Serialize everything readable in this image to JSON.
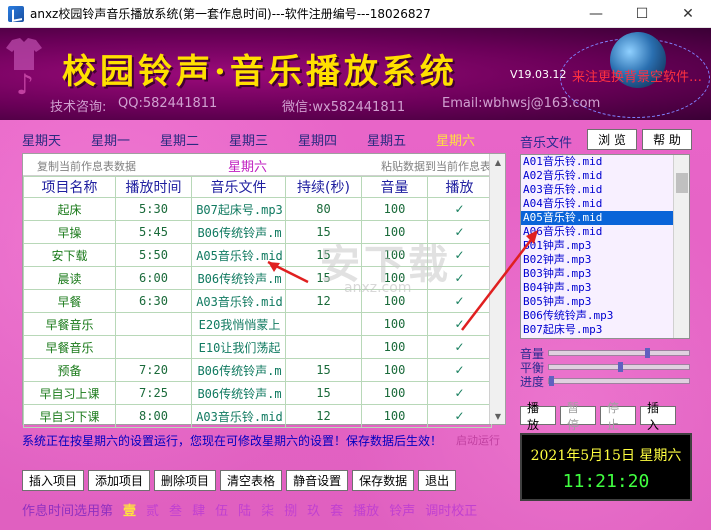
{
  "window": {
    "title": "anxz校园铃声音乐播放系统(第一套作息时间)---软件注册编号---18026827",
    "minimize": "—",
    "maximize": "☐",
    "close": "✕"
  },
  "banner": {
    "title": "校园铃声·音乐播放系统",
    "version": "V19.03.12",
    "scroll_text": "来注更换背景空软件…",
    "tech": "技术咨询:",
    "qq": "QQ:582441811",
    "wechat": "微信:wx582441811",
    "email": "Email:wbhwsj@163.com"
  },
  "weekdays": [
    "星期天",
    "星期一",
    "星期二",
    "星期三",
    "星期四",
    "星期五",
    "星期六"
  ],
  "active_weekday": 6,
  "schedule": {
    "copy_label": "复制当前作息表数据",
    "paste_label": "粘贴数据到当前作息表",
    "day_label": "星期六",
    "headers": [
      "项目名称",
      "播放时间",
      "音乐文件",
      "持续(秒)",
      "音量",
      "播放"
    ],
    "rows": [
      {
        "name": "起床",
        "time": "5:30",
        "file": "B07起床号.mp3",
        "dur": "80",
        "vol": "100",
        "play": "✓"
      },
      {
        "name": "早操",
        "time": "5:45",
        "file": "B06传统铃声.m",
        "dur": "15",
        "vol": "100",
        "play": "✓"
      },
      {
        "name": "安下载",
        "time": "5:50",
        "file": "A05音乐铃.mid",
        "dur": "15",
        "vol": "100",
        "play": "✓"
      },
      {
        "name": "晨读",
        "time": "6:00",
        "file": "B06传统铃声.m",
        "dur": "15",
        "vol": "100",
        "play": "✓"
      },
      {
        "name": "早餐",
        "time": "6:30",
        "file": "A03音乐铃.mid",
        "dur": "12",
        "vol": "100",
        "play": "✓"
      },
      {
        "name": "早餐音乐",
        "time": "",
        "file": "E20我悄悄蒙上",
        "dur": "",
        "vol": "100",
        "play": "✓"
      },
      {
        "name": "早餐音乐",
        "time": "",
        "file": "E10让我们荡起",
        "dur": "",
        "vol": "100",
        "play": "✓"
      },
      {
        "name": "预备",
        "time": "7:20",
        "file": "B06传统铃声.m",
        "dur": "15",
        "vol": "100",
        "play": "✓"
      },
      {
        "name": "早自习上课",
        "time": "7:25",
        "file": "B06传统铃声.m",
        "dur": "15",
        "vol": "100",
        "play": "✓"
      },
      {
        "name": "早自习下课",
        "time": "8:00",
        "file": "A03音乐铃.mid",
        "dur": "12",
        "vol": "100",
        "play": "✓"
      }
    ]
  },
  "status": {
    "message": "系统正在按星期六的设置运行，您现在可修改星期六的设置！保存数据后生效！",
    "right": "启动运行"
  },
  "bottom_buttons": [
    "插入项目",
    "添加项目",
    "删除项目",
    "清空表格",
    "静音设置",
    "保存数据",
    "退出"
  ],
  "preset": {
    "label": "作息时间选用第",
    "items": [
      "壹",
      "贰",
      "叁",
      "肆",
      "伍",
      "陆",
      "柒",
      "捌",
      "玖"
    ],
    "active": 0,
    "suffix": "套",
    "extra1": "播放",
    "extra2": "铃声",
    "extra3": "调时校正"
  },
  "music": {
    "label": "音乐文件",
    "browse": "浏 览",
    "help": "帮 助",
    "files": [
      "A01音乐铃.mid",
      "A02音乐铃.mid",
      "A03音乐铃.mid",
      "A04音乐铃.mid",
      "A05音乐铃.mid",
      "A06音乐铃.mid",
      "B01钟声.mp3",
      "B02钟声.mp3",
      "B03钟声.mp3",
      "B04钟声.mp3",
      "B05钟声.mp3",
      "B06传统铃声.mp3",
      "B07起床号.mp3"
    ],
    "selected": 4
  },
  "sliders": {
    "volume_label": "音量",
    "volume": 0.7,
    "balance_label": "平衡",
    "balance": 0.5,
    "progress_label": "进度",
    "progress": 0.0
  },
  "player_buttons": [
    "播放",
    "暂停",
    "停止",
    "插入"
  ],
  "clock": {
    "date": "2021年5月15日 星期六",
    "time": "11:21:20"
  },
  "watermark": {
    "text": "安下载",
    "sub": "anxz.com"
  },
  "colors": {
    "banner_title": "#ffe000",
    "main_bg": "#e865c8",
    "selected_item": "#0a64d8"
  }
}
